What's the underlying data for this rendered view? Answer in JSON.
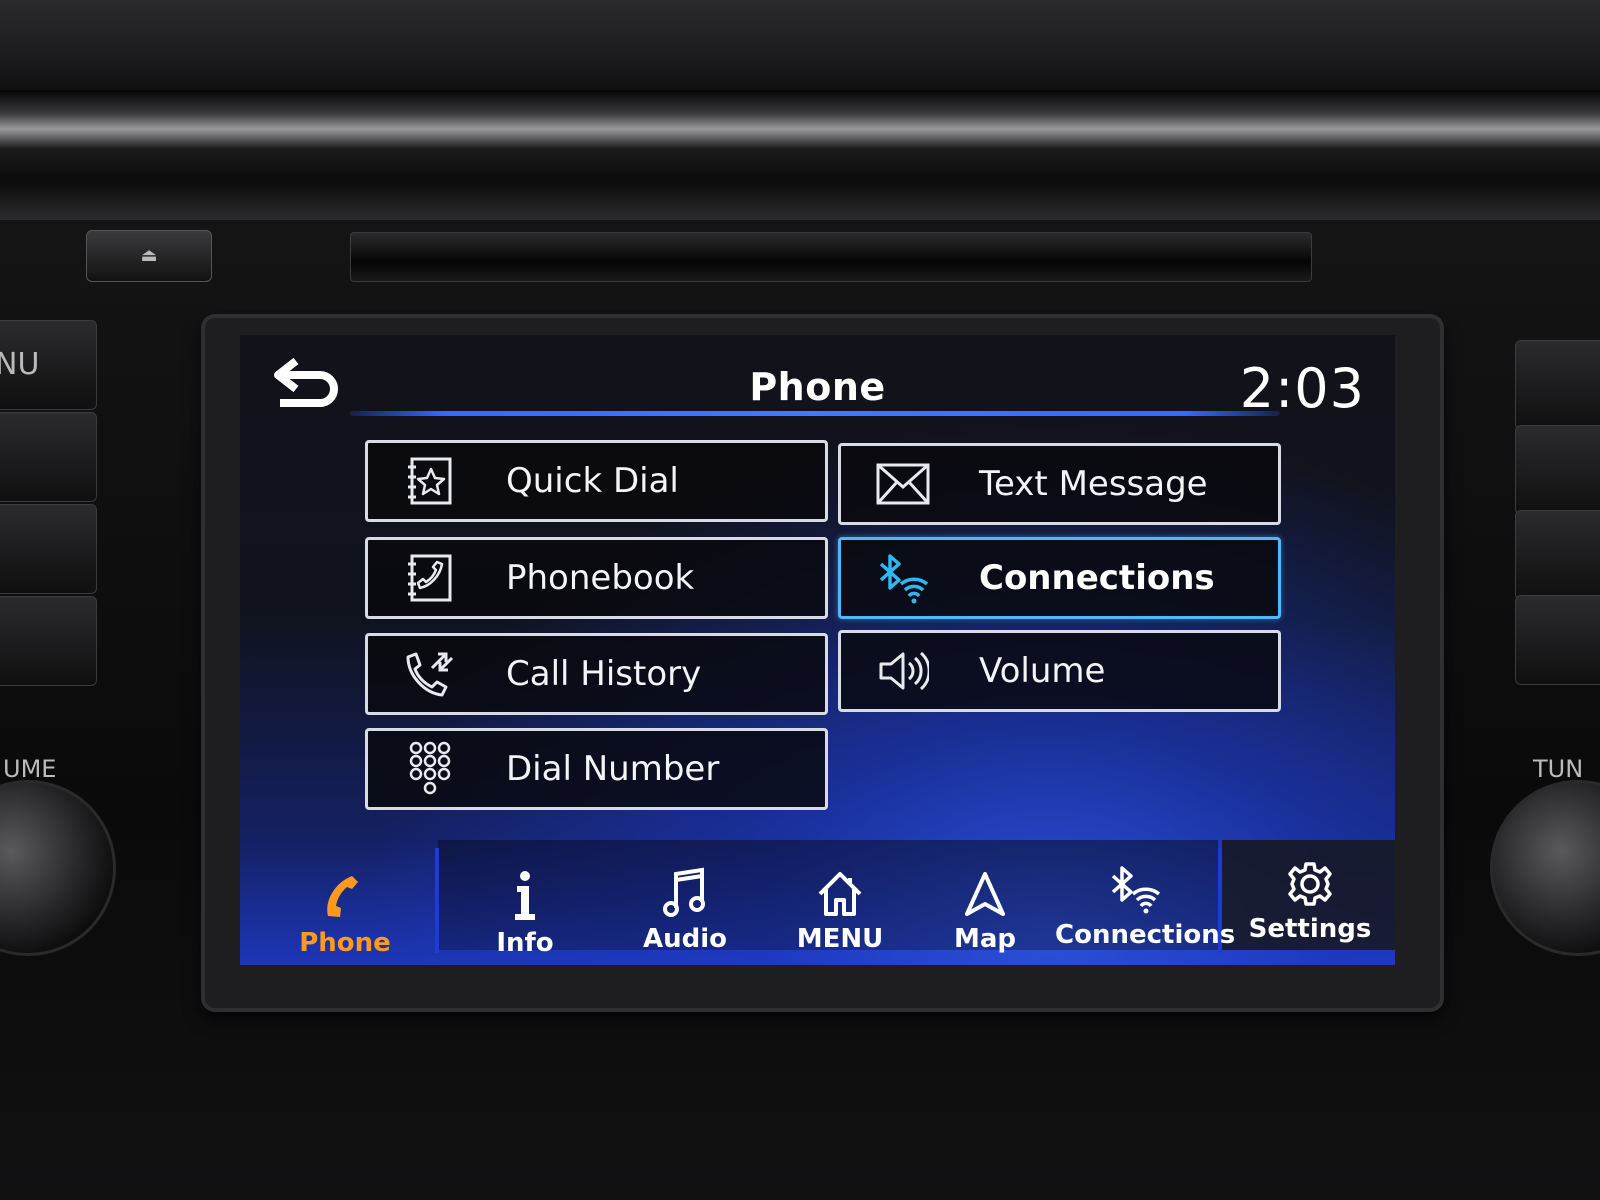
{
  "header": {
    "title": "Phone",
    "clock": "2:03",
    "back_icon": "back-arrow-icon"
  },
  "menu": {
    "items": [
      {
        "label": "Quick Dial",
        "icon": "quick-dial-star-book-icon",
        "selected": false
      },
      {
        "label": "Text Message",
        "icon": "envelope-icon",
        "selected": false
      },
      {
        "label": "Phonebook",
        "icon": "phonebook-icon",
        "selected": false
      },
      {
        "label": "Connections",
        "icon": "bluetooth-wifi-icon",
        "selected": true
      },
      {
        "label": "Call History",
        "icon": "call-history-icon",
        "selected": false
      },
      {
        "label": "Volume",
        "icon": "speaker-volume-icon",
        "selected": false
      },
      {
        "label": "Dial Number",
        "icon": "keypad-icon",
        "selected": false
      }
    ]
  },
  "bottom_nav": {
    "items": [
      {
        "label": "Phone",
        "icon": "phone-handset-icon",
        "current": true
      },
      {
        "label": "Info",
        "icon": "info-icon",
        "current": false
      },
      {
        "label": "Audio",
        "icon": "music-note-icon",
        "current": false
      },
      {
        "label": "MENU",
        "icon": "home-icon",
        "current": false
      },
      {
        "label": "Map",
        "icon": "navigation-arrow-icon",
        "current": false
      },
      {
        "label": "Connections",
        "icon": "bluetooth-wifi-icon",
        "current": false
      },
      {
        "label": "Settings",
        "icon": "gear-icon",
        "current": false
      }
    ]
  },
  "colors": {
    "accent_active": "#ff9a1f",
    "selection_border": "#4fb7ff",
    "title_rule": "#3d7bff",
    "bluetooth_icon": "#2fb8f0"
  },
  "hardware": {
    "left_label_fragment_top": "NU",
    "left_label_fragment_knob": "UME",
    "right_label_fragment_knob": "TUN"
  }
}
